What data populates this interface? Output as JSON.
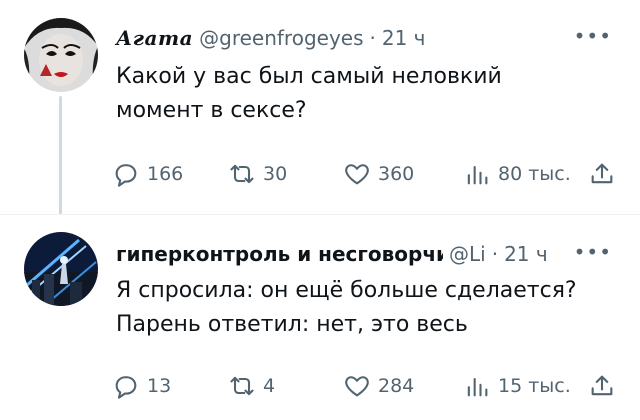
{
  "tweets": [
    {
      "display_name": "Агата",
      "handle": "@greenfrogeyes",
      "separator": "·",
      "time": "21 ч",
      "more_icon": "more-icon",
      "text_lines": [
        "Какой у вас был самый неловкий",
        "момент в сексе?"
      ],
      "stats": {
        "replies": "166",
        "retweets": "30",
        "likes": "360",
        "views": "80 тыс."
      }
    },
    {
      "display_name": "гиперконтроль и несговорчивость",
      "handle": "@Li",
      "separator": "·",
      "time": "21 ч",
      "more_icon": "more-icon",
      "text_lines": [
        "Я спросила: он ещё больше сделается?",
        "Парень ответил: нет, это весь"
      ],
      "stats": {
        "replies": "13",
        "retweets": "4",
        "likes": "284",
        "views": "15 тыс."
      }
    }
  ],
  "colors": {
    "text": "#0f1419",
    "secondary": "#536471",
    "thread_line": "#cfd9de"
  }
}
